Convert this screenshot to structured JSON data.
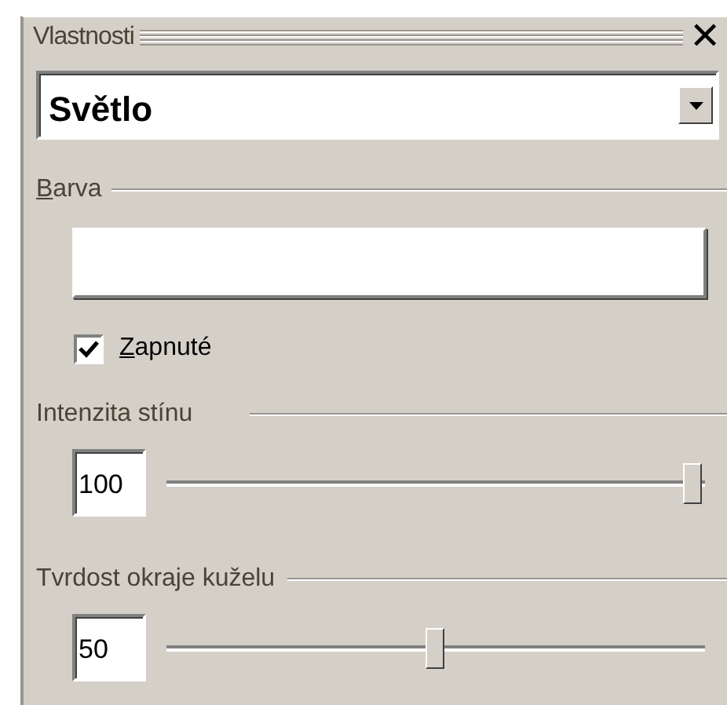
{
  "panel": {
    "title": "Vlastnosti",
    "close": "✕"
  },
  "object_select": {
    "value": "Světlo"
  },
  "color": {
    "label": "Barva"
  },
  "enabled": {
    "label": "Zapnuté",
    "checked": true
  },
  "sliders": [
    {
      "label": "Intenzita stínu",
      "value": "100",
      "level": 1.0
    },
    {
      "label": "Tvrdost okraje kuželu",
      "value": "50",
      "level": 0.5
    }
  ]
}
